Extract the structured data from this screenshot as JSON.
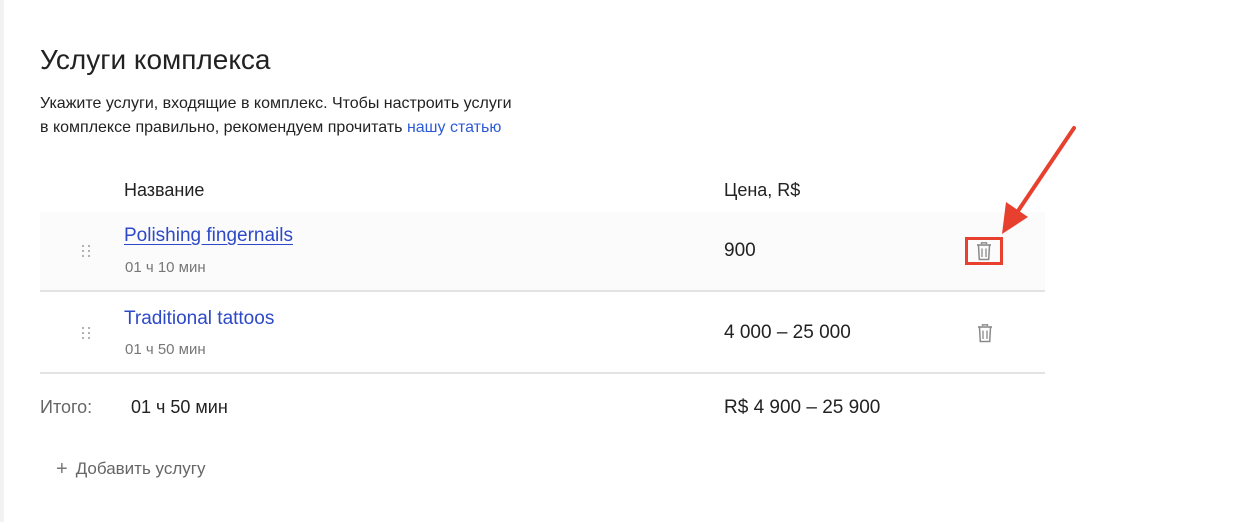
{
  "section": {
    "title": "Услуги комплекса",
    "description_line1": "Укажите услуги, входящие в комплекс. Чтобы настроить услуги",
    "description_line2": "в комплексе правильно, рекомендуем прочитать ",
    "article_link": "нашу статью"
  },
  "table": {
    "col_name": "Название",
    "col_price": "Цена, R$",
    "rows": [
      {
        "name": "Polishing fingernails",
        "duration": "01 ч 10 мин",
        "price": "900",
        "delete_icon": "trash-icon"
      },
      {
        "name": "Traditional tattoos",
        "duration": "01 ч 50 мин",
        "price": "4 000 – 25 000",
        "delete_icon": "trash-icon"
      }
    ]
  },
  "total": {
    "label": "Итого:",
    "duration": "01 ч 50 мин",
    "price": "R$ 4 900 – 25 900"
  },
  "actions": {
    "add_service": "Добавить услугу"
  },
  "colors": {
    "link": "#2d49c7",
    "annotation": "#e8402e"
  }
}
